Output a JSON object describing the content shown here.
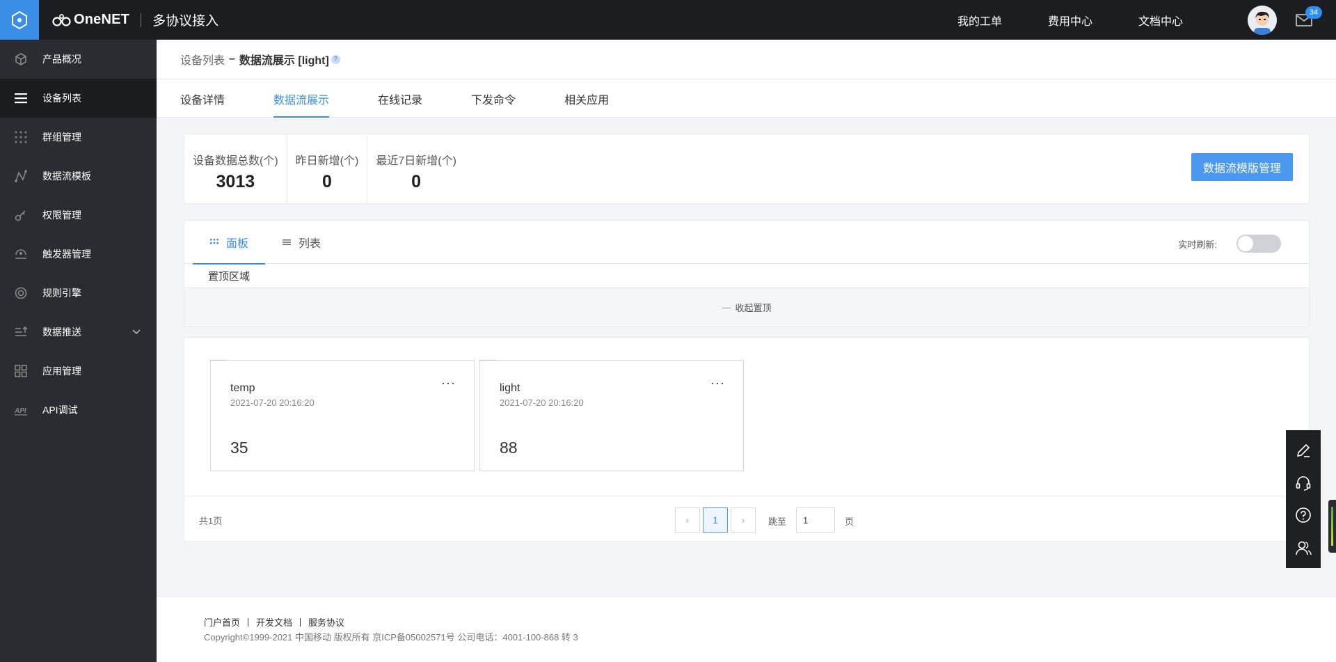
{
  "topbar": {
    "brand": "OneNET",
    "subtitle": "多协议接入",
    "nav": [
      "我的工单",
      "费用中心",
      "文档中心"
    ],
    "mail_count": "34"
  },
  "sidebar": {
    "items": [
      {
        "label": "产品概况",
        "icon": "cube-icon"
      },
      {
        "label": "设备列表",
        "icon": "list-icon"
      },
      {
        "label": "群组管理",
        "icon": "grid-dots-icon"
      },
      {
        "label": "数据流模板",
        "icon": "line-node-icon"
      },
      {
        "label": "权限管理",
        "icon": "key-icon"
      },
      {
        "label": "触发器管理",
        "icon": "trigger-icon"
      },
      {
        "label": "规则引擎",
        "icon": "target-icon"
      },
      {
        "label": "数据推送",
        "icon": "push-icon"
      },
      {
        "label": "应用管理",
        "icon": "apps-icon"
      },
      {
        "label": "API调试",
        "icon": "api-icon"
      }
    ]
  },
  "breadcrumb": {
    "parent": "设备列表",
    "separator": "–",
    "current": "数据流展示 [light]",
    "help": "?"
  },
  "tabs": [
    "设备详情",
    "数据流展示",
    "在线记录",
    "下发命令",
    "相关应用"
  ],
  "stats": [
    {
      "label": "设备数据总数(个)",
      "value": "3013"
    },
    {
      "label": "昨日新增(个)",
      "value": "0"
    },
    {
      "label": "最近7日新增(个)",
      "value": "0"
    }
  ],
  "manage_button": "数据流模版管理",
  "view_tabs": [
    "面板",
    "列表"
  ],
  "realtime_label": "实时刷新:",
  "pinned": {
    "label": "置顶区域",
    "collapse": "收起置顶"
  },
  "datastreams": [
    {
      "name": "temp",
      "time": "2021-07-20 20:16:20",
      "value": "35",
      "more": "···"
    },
    {
      "name": "light",
      "time": "2021-07-20 20:16:20",
      "value": "88",
      "more": "···"
    }
  ],
  "pager": {
    "total": "共1页",
    "prev": "‹",
    "current": "1",
    "next": "›",
    "jump_label": "跳至",
    "jump_value": "1",
    "page_unit": "页"
  },
  "footer": {
    "links": [
      "门户首页",
      "开发文档",
      "服务协议"
    ],
    "copyright": "Copyright©1999-2021 中国移动 版权所有 京ICP备05002571号 公司电话：4001-100-868 转 3"
  },
  "colors": {
    "accent": "#3a8ee6",
    "topbar": "#1b1d20",
    "sidebar": "#2a2c31"
  }
}
